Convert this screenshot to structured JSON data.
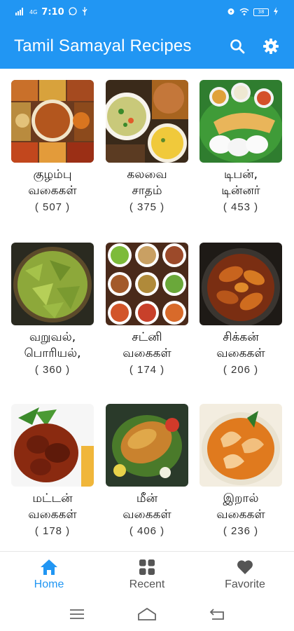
{
  "status_bar": {
    "carrier": "4G",
    "time": "7:10",
    "battery": "38",
    "left_icons": [
      "whatsapp-icon",
      "usb-icon"
    ],
    "right_icons": [
      "alarm-icon",
      "wifi-icon",
      "battery-icon",
      "charging-icon"
    ]
  },
  "app_bar": {
    "title": "Tamil Samayal Recipes",
    "background": "#2196f3",
    "actions": [
      "search-icon",
      "gear-icon"
    ]
  },
  "categories": [
    {
      "line1": "குழம்பு",
      "line2": "வகைகள்",
      "count": "( 507 )"
    },
    {
      "line1": "கலவை",
      "line2": "சாதம்",
      "count": "( 375 )"
    },
    {
      "line1": "டிபன்,",
      "line2": "டின்னர்",
      "count": "( 453 )"
    },
    {
      "line1": "வறுவல்,",
      "line2": "பொரியல்,",
      "count": "( 360 )"
    },
    {
      "line1": "சட்னி",
      "line2": "வகைகள்",
      "count": "( 174 )"
    },
    {
      "line1": "சிக்கன்",
      "line2": "வகைகள்",
      "count": "( 206 )"
    },
    {
      "line1": "மட்டன்",
      "line2": "வகைகள்",
      "count": "( 178 )"
    },
    {
      "line1": "மீன்",
      "line2": "வகைகள்",
      "count": "( 406 )"
    },
    {
      "line1": "இறால்",
      "line2": "வகைகள்",
      "count": "( 236 )"
    }
  ],
  "bottom_nav": {
    "items": [
      {
        "label": "Home",
        "icon": "home-icon",
        "active": true
      },
      {
        "label": "Recent",
        "icon": "grid-icon",
        "active": false
      },
      {
        "label": "Favorite",
        "icon": "heart-icon",
        "active": false
      }
    ],
    "active_color": "#2196f3"
  },
  "system_nav": [
    "menu-icon",
    "home-outline-icon",
    "back-icon"
  ]
}
